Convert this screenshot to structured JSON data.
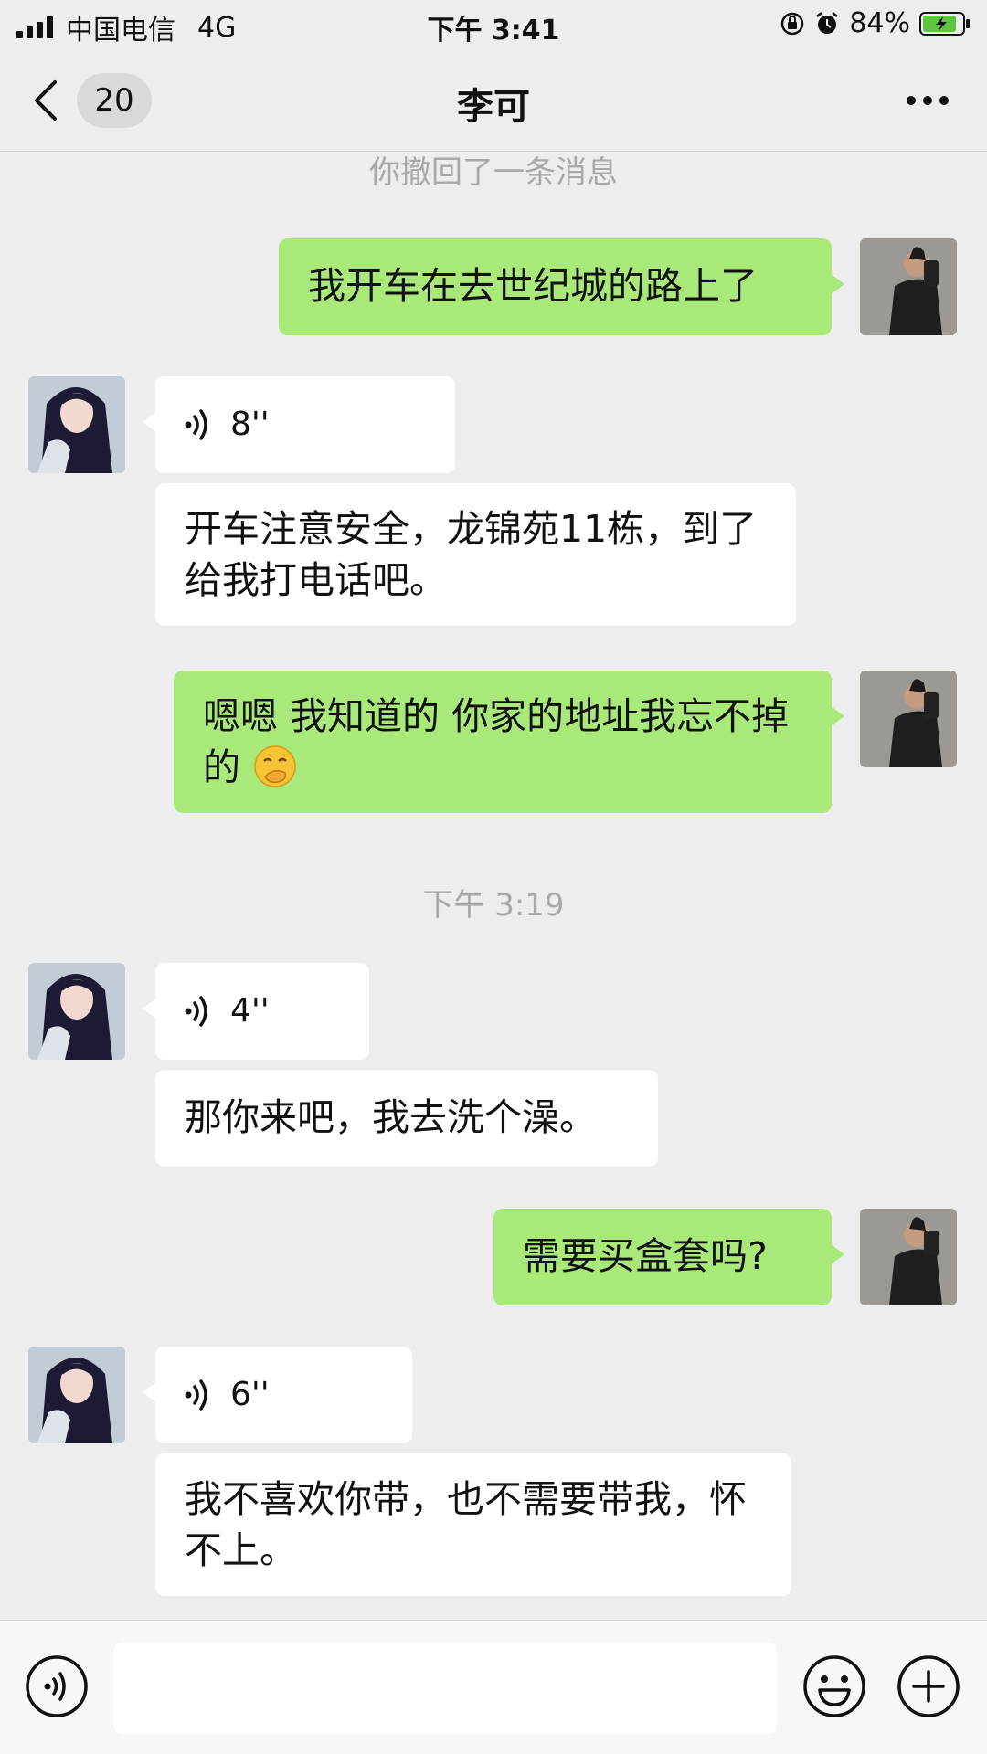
{
  "status_bar": {
    "carrier": "中国电信",
    "network": "4G",
    "time": "下午 3:41",
    "battery": "84%"
  },
  "header": {
    "unread_count": "20",
    "title": "李可"
  },
  "messages": {
    "recall_notice": "你撤回了一条消息",
    "m1": "我开车在去世纪城的路上了",
    "v1_duration": "8''",
    "m2": "开车注意安全，龙锦苑11栋，到了给我打电话吧。",
    "m3": "嗯嗯 我知道的 你家的地址我忘不掉的",
    "timestamp": "下午 3:19",
    "v2_duration": "4''",
    "m4": "那你来吧，我去洗个澡。",
    "m5": "需要买盒套吗?",
    "v3_duration": "6''",
    "m6": "我不喜欢你带，也不需要带我，怀不上。"
  },
  "colors": {
    "background": "#ededed",
    "my_bubble": "#a9e97a",
    "their_bubble": "#ffffff",
    "system_text": "#a8a8a8",
    "battery_fill": "#5ac73e"
  },
  "icons": {
    "back": "chevron-left-icon",
    "more": "more-dots-icon",
    "voice": "voice-wave-icon",
    "emoji": "smiley-icon",
    "plus": "plus-circle-icon",
    "voice_input": "voice-input-icon"
  }
}
